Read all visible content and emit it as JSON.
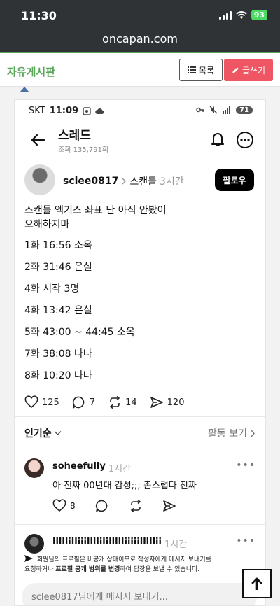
{
  "status_bar": {
    "time": "11:30",
    "battery": "93"
  },
  "browser": {
    "url": "oncapan.com"
  },
  "site_header": {
    "title": "자유게시판",
    "list_button": "목록",
    "write_button": "글쓰기"
  },
  "phone": {
    "status": {
      "carrier": "SKT",
      "time": "11:09",
      "battery": "71"
    },
    "thread": {
      "title": "스레드",
      "views": "조회 135,791회"
    },
    "post": {
      "author": "sclee0817",
      "community": "스캔들",
      "time": "3시간",
      "follow_label": "팔로우",
      "intro_line1": "스캔들 엑기스 좌표 난 아직 안봤어",
      "intro_line2": "오해하지마",
      "lines": [
        "1화 16:56 소옥",
        "2화 31:46 은실",
        "4화 시작 3명",
        "4화 13:42 은실",
        "5화 43:00 ~ 44:45 소옥",
        "7화 38:08 나나",
        "8화 10:20 나나"
      ],
      "likes": "125",
      "comments": "7",
      "reposts": "14",
      "shares": "120"
    },
    "sort": {
      "label": "인기순",
      "activity_link": "활동 보기"
    },
    "comments": [
      {
        "user": "soheefully",
        "time": "1시간",
        "text": "아 진짜 00년대 감성;;; 촌스럽다 진짜",
        "likes": "8"
      },
      {
        "user": "lllllilliiillllilillllliiiiilllllii",
        "time": "1시간"
      }
    ],
    "notice_prefix": "회원님의 프로필은 비공개 상태이므로 작성자에게 메시지 보내기를",
    "notice_mid": "요청하거나 ",
    "notice_bold": "프로필 공개 범위를 변경",
    "notice_suffix": "하여 답장을 보낼 수 있습니다.",
    "message_placeholder": "sclee0817님에게 메시지 보내기..."
  },
  "colors": {
    "accent_green": "#58a558",
    "write_red": "#ee5663",
    "dark_bar": "#2f3336"
  }
}
